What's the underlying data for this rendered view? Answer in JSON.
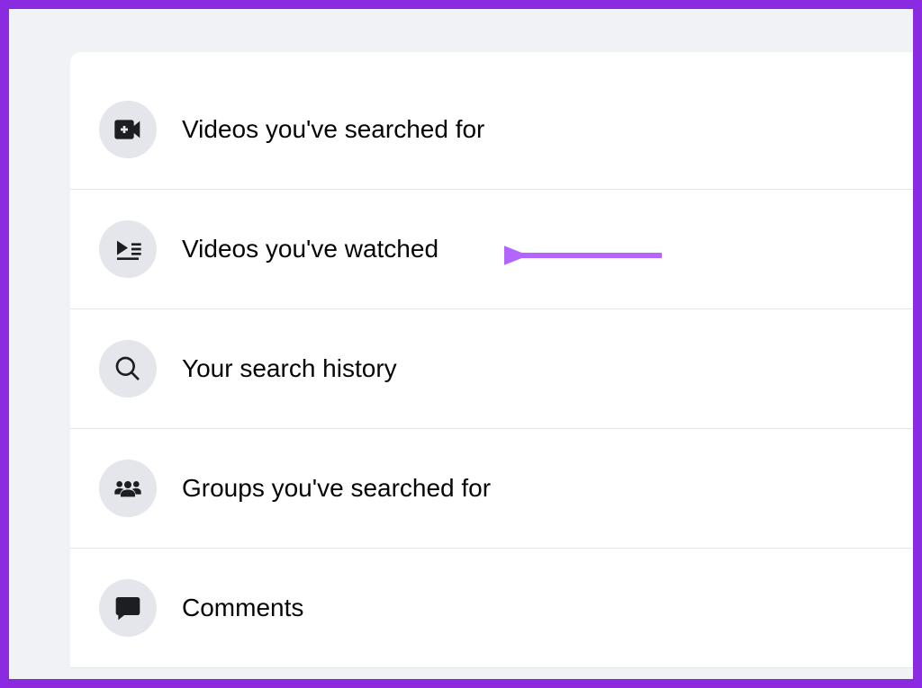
{
  "items": [
    {
      "label": "Videos you've searched for",
      "icon": "video-add-icon"
    },
    {
      "label": "Videos you've watched",
      "icon": "video-list-icon"
    },
    {
      "label": "Your search history",
      "icon": "search-icon"
    },
    {
      "label": "Groups you've searched for",
      "icon": "groups-icon"
    },
    {
      "label": "Comments",
      "icon": "comment-icon"
    }
  ],
  "annotation": {
    "arrow_color": "#b266ff",
    "target_index": 1
  }
}
